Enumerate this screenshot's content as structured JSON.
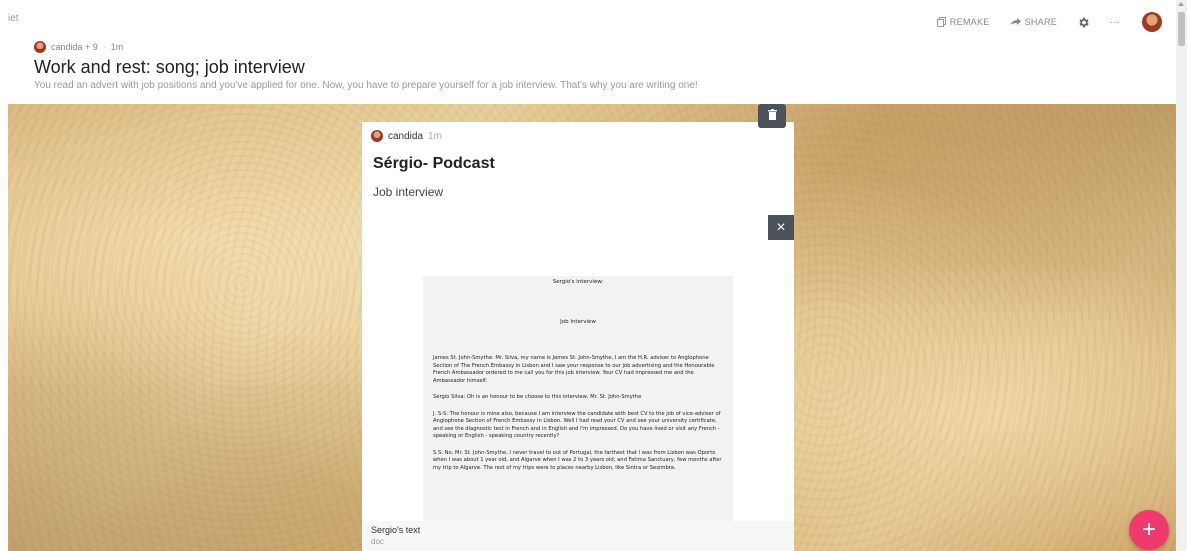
{
  "header": {
    "crumb": "iet",
    "remake_label": "REMAKE",
    "share_label": "SHARE",
    "more_label": "···",
    "meta": {
      "author": "candida + 9",
      "separator": "·",
      "time": "1m"
    },
    "title": "Work and rest: song; job interview",
    "subtitle": "You read an advert with job positions and you've applied for one. Now, you have to prepare yourself for a job interview. That's why you are writing one!"
  },
  "post": {
    "author": "candida",
    "time": "1m",
    "title": "Sérgio- Podcast",
    "body": "Job interview",
    "close_label": "×",
    "document": {
      "heading": "Sergio's interview:",
      "subheading": "Job Interview",
      "paragraphs": [
        "James St. John-Smythe: Mr. Silva, my name is James St. John-Smythe, I am the H.R. adviser to Anglophone Section of The French Embassy in Lisbon and I saw your response to our job advertising and the Honourable French Ambassador ordered to me call you for this job interview. Your CV had impressed me and the Ambassador himself.",
        "Sérgio Silva: Oh is an honour to be choose to this interview, Mr. St. John-Smythe",
        "J. S-S: The honour is mine also, because I am interview the candidate with best CV to the job of vice-adviser of Anglophone Section of French Embassy in Lisbon. Well I had read your CV and see your university certificate, and see the diagnostic test in French and in English and I'm impressed. Do you have lived or visit any French - speaking or English - speaking country recently?",
        "S.S: No, Mr. St. John-Smythe, I never travel to out of Portugal, the farthest that I was from Lisbon was Oporto when I was about 1 year old, and Algarve when I was 2 to 3 years old; and Fatima Sanctuary, few months after my trip to Algarve. The rest of my trips were to places nearby Lisbon, like Sintra or Sesimbra."
      ]
    },
    "attachment": {
      "name": "Sergio's text",
      "type": "doc"
    }
  },
  "fab_label": "+",
  "colors": {
    "fab": "#f03a6e",
    "dark_button": "#4a525a"
  }
}
